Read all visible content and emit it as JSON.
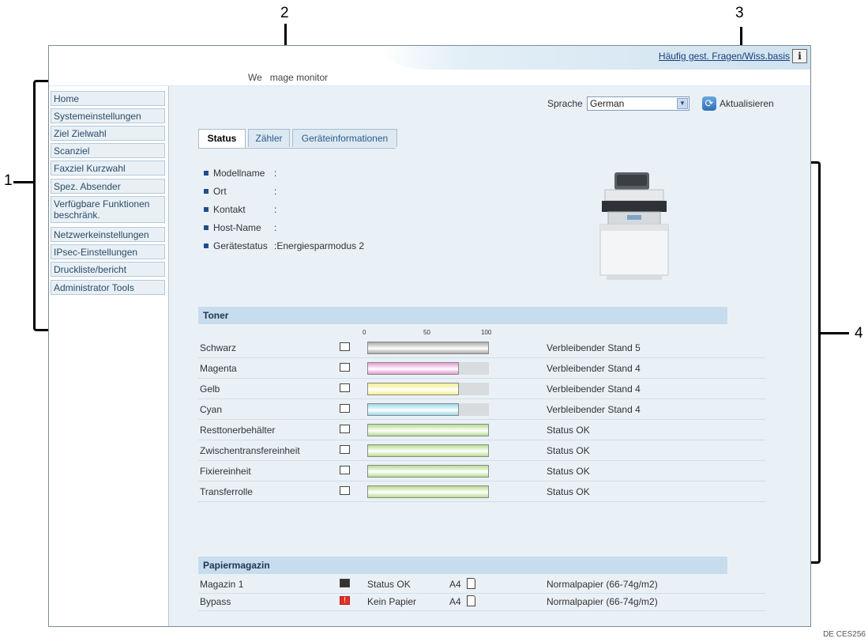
{
  "callouts": [
    "1",
    "2",
    "3",
    "4"
  ],
  "header": {
    "faq_link": "Häufig gest. Fragen/Wiss.basis",
    "info_icon": "i",
    "app_title": "We   mage monitor"
  },
  "sidebar": {
    "items": [
      {
        "label": "Home"
      },
      {
        "label": "Systemeinstellungen"
      },
      {
        "label": "Ziel Zielwahl"
      },
      {
        "label": "Scanziel"
      },
      {
        "label": "Faxziel Kurzwahl"
      },
      {
        "label": "Spez. Absender"
      },
      {
        "label": "Verfügbare Funktionen beschränk."
      },
      {
        "label": "Netzwerkeinstellungen"
      },
      {
        "label": "IPsec-Einstellungen"
      },
      {
        "label": "Druckliste/bericht"
      },
      {
        "label": "Administrator Tools"
      }
    ]
  },
  "language": {
    "label": "Sprache",
    "selected": "German",
    "refresh_label": "Aktualisieren"
  },
  "tabs": [
    {
      "label": "Status",
      "active": true
    },
    {
      "label": "Zähler",
      "active": false
    },
    {
      "label": "Geräteinformationen",
      "active": false
    }
  ],
  "device_info": [
    {
      "label": "Modellname",
      "value": ""
    },
    {
      "label": "Ort",
      "value": ""
    },
    {
      "label": "Kontakt",
      "value": ""
    },
    {
      "label": "Host-Name",
      "value": ""
    },
    {
      "label": "Gerätestatus",
      "value": "Energiesparmodus 2"
    }
  ],
  "toner": {
    "heading": "Toner",
    "scale": [
      "0",
      "50",
      "100"
    ],
    "rows": [
      {
        "name": "Schwarz",
        "level": 100,
        "color": "#a8a8a8",
        "status": "Verbleibender Stand 5",
        "icon": "toner-icon"
      },
      {
        "name": "Magenta",
        "level": 75,
        "color": "#e59ad0",
        "status": "Verbleibender Stand 4",
        "icon": "toner-icon"
      },
      {
        "name": "Gelb",
        "level": 75,
        "color": "#f3f08a",
        "status": "Verbleibender Stand 4",
        "icon": "toner-icon"
      },
      {
        "name": "Cyan",
        "level": 75,
        "color": "#98d8ea",
        "status": "Verbleibender Stand 4",
        "icon": "toner-icon"
      },
      {
        "name": "Resttonerbehälter",
        "level": 100,
        "color": "#b6dd8e",
        "status": "Status OK",
        "icon": "waste-toner-icon"
      },
      {
        "name": "Zwischentransfereinheit",
        "level": 100,
        "color": "#b6dd8e",
        "status": "Status OK",
        "icon": "transfer-unit-icon"
      },
      {
        "name": "Fixiereinheit",
        "level": 100,
        "color": "#b6dd8e",
        "status": "Status OK",
        "icon": "fuser-icon"
      },
      {
        "name": "Transferrolle",
        "level": 100,
        "color": "#b6dd8e",
        "status": "Status OK",
        "icon": "transfer-roller-icon"
      }
    ]
  },
  "paper": {
    "heading": "Papiermagazin",
    "rows": [
      {
        "name": "Magazin 1",
        "status": "Status OK",
        "size": "A4",
        "type": "Normalpapier (66-74g/m2)",
        "icon": "tray-icon",
        "alert": false
      },
      {
        "name": "Bypass",
        "status": "Kein Papier",
        "size": "A4",
        "type": "Normalpapier (66-74g/m2)",
        "icon": "bypass-empty-icon",
        "alert": true
      }
    ]
  },
  "footer_code": "DE CES256"
}
